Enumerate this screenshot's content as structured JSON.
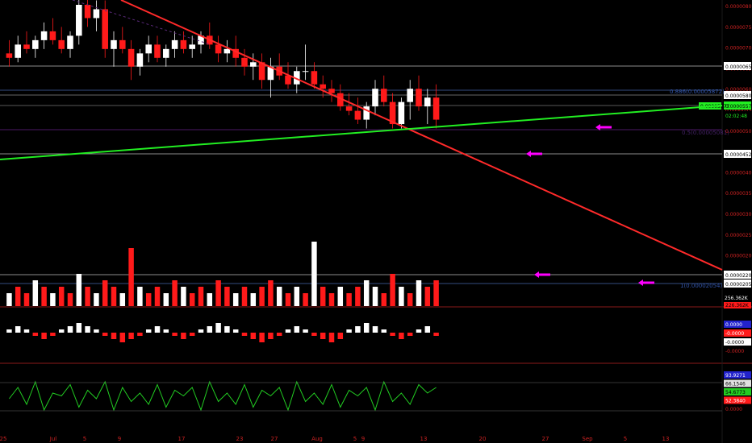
{
  "chart_data": {
    "type": "candlestick",
    "colors": {
      "background": "#000000",
      "up": "#ffffff",
      "down": "#ff1a1a",
      "axis_text": "#cc2222",
      "red_trend": "#ff2a2a",
      "green_trend": "#22ee22",
      "arrow": "#ff00ff",
      "fib": "#2255aa",
      "blue_line": "#1a30c8",
      "grey_line": "#d0d0d0",
      "orange_line": "#e87a2a",
      "green_osc": "#22cc22",
      "band": "#2a3a55"
    },
    "x_ticks": [
      "25",
      "Jul",
      "5",
      "9",
      "17",
      "23",
      "27",
      "Aug",
      "5",
      "9",
      "13",
      "20",
      "27",
      "Sep",
      "5",
      "13"
    ],
    "price_ticks": [
      "0.00000800",
      "0.00000750",
      "0.00000700",
      "0.00000650",
      "0.00000600",
      "0.00000550",
      "0.00000500",
      "0.00000450",
      "0.00000400",
      "0.00000350",
      "0.00000300",
      "0.00000250",
      "0.00000200"
    ],
    "price_labels": [
      {
        "text": "0.00000650",
        "value": 6.5e-06,
        "style": "outline"
      },
      {
        "text": "0.00005801",
        "value": 5.8e-06,
        "style": "plain"
      },
      {
        "text": "0.00005577",
        "value": 5.56e-06,
        "style": "plain"
      },
      {
        "text": "02:02:48",
        "value": 5.35e-06,
        "style": "timer"
      },
      {
        "text": "0.00004522",
        "value": 4.5e-06,
        "style": "plain"
      },
      {
        "text": "0.00002200",
        "value": 2.2e-06,
        "style": "outline"
      },
      {
        "text": "0.00002054",
        "value": 2.1e-06,
        "style": "plain"
      }
    ],
    "fib_labels": [
      {
        "text": "0.886(0.00005872)",
        "value": 5.85e-06
      },
      {
        "text": "0.5(0.00005081)",
        "value": 5.1e-06
      },
      {
        "text": "1(0.00002054)",
        "value": 2.1e-06
      }
    ],
    "current_price_tag": "0.00005577",
    "volume_labels": [
      "256.362K",
      "226.362K"
    ],
    "macd_labels": [
      "0.0000",
      "-0.0000",
      "-0.0000",
      "-0.0000"
    ],
    "stoch_labels": [
      "93.9271",
      "66.1546",
      "54.6773",
      "52.3840",
      "0.0000"
    ],
    "candles": [
      {
        "o": 6.9,
        "h": 7.2,
        "l": 6.6,
        "c": 6.8
      },
      {
        "o": 6.8,
        "h": 7.3,
        "l": 6.7,
        "c": 7.1
      },
      {
        "o": 7.1,
        "h": 7.4,
        "l": 6.9,
        "c": 7.0
      },
      {
        "o": 7.0,
        "h": 7.3,
        "l": 6.8,
        "c": 7.2
      },
      {
        "o": 7.2,
        "h": 7.6,
        "l": 7.0,
        "c": 7.4
      },
      {
        "o": 7.4,
        "h": 7.7,
        "l": 7.1,
        "c": 7.2
      },
      {
        "o": 7.2,
        "h": 7.5,
        "l": 6.9,
        "c": 7.0
      },
      {
        "o": 7.0,
        "h": 7.4,
        "l": 6.8,
        "c": 7.3
      },
      {
        "o": 7.3,
        "h": 8.2,
        "l": 7.1,
        "c": 8.0
      },
      {
        "o": 8.0,
        "h": 8.3,
        "l": 7.5,
        "c": 7.7
      },
      {
        "o": 7.7,
        "h": 8.1,
        "l": 7.4,
        "c": 7.9
      },
      {
        "o": 7.9,
        "h": 8.1,
        "l": 6.8,
        "c": 7.0
      },
      {
        "o": 7.0,
        "h": 7.4,
        "l": 6.6,
        "c": 7.2
      },
      {
        "o": 7.2,
        "h": 7.5,
        "l": 6.9,
        "c": 7.0
      },
      {
        "o": 7.0,
        "h": 7.2,
        "l": 6.3,
        "c": 6.6
      },
      {
        "o": 6.6,
        "h": 7.0,
        "l": 6.4,
        "c": 6.9
      },
      {
        "o": 6.9,
        "h": 7.3,
        "l": 6.7,
        "c": 7.1
      },
      {
        "o": 7.1,
        "h": 7.3,
        "l": 6.7,
        "c": 6.8
      },
      {
        "o": 6.8,
        "h": 7.1,
        "l": 6.6,
        "c": 7.0
      },
      {
        "o": 7.0,
        "h": 7.4,
        "l": 6.8,
        "c": 7.2
      },
      {
        "o": 7.2,
        "h": 7.4,
        "l": 6.9,
        "c": 7.0
      },
      {
        "o": 7.0,
        "h": 7.3,
        "l": 6.8,
        "c": 7.1
      },
      {
        "o": 7.1,
        "h": 7.4,
        "l": 6.9,
        "c": 7.3
      },
      {
        "o": 7.3,
        "h": 7.6,
        "l": 7.0,
        "c": 7.1
      },
      {
        "o": 7.1,
        "h": 7.3,
        "l": 6.7,
        "c": 6.9
      },
      {
        "o": 6.9,
        "h": 7.2,
        "l": 6.7,
        "c": 7.0
      },
      {
        "o": 7.0,
        "h": 7.3,
        "l": 6.6,
        "c": 6.8
      },
      {
        "o": 6.8,
        "h": 7.0,
        "l": 6.4,
        "c": 6.6
      },
      {
        "o": 6.6,
        "h": 6.9,
        "l": 6.3,
        "c": 6.7
      },
      {
        "o": 6.7,
        "h": 6.9,
        "l": 6.1,
        "c": 6.3
      },
      {
        "o": 6.3,
        "h": 6.8,
        "l": 5.9,
        "c": 6.6
      },
      {
        "o": 6.6,
        "h": 6.9,
        "l": 6.3,
        "c": 6.4
      },
      {
        "o": 6.4,
        "h": 6.7,
        "l": 6.1,
        "c": 6.2
      },
      {
        "o": 6.2,
        "h": 6.6,
        "l": 6.0,
        "c": 6.5
      },
      {
        "o": 6.5,
        "h": 7.1,
        "l": 6.3,
        "c": 6.5
      },
      {
        "o": 6.5,
        "h": 6.7,
        "l": 6.1,
        "c": 6.2
      },
      {
        "o": 6.2,
        "h": 6.4,
        "l": 5.9,
        "c": 6.1
      },
      {
        "o": 6.1,
        "h": 6.3,
        "l": 5.8,
        "c": 6.0
      },
      {
        "o": 6.0,
        "h": 6.2,
        "l": 5.6,
        "c": 5.7
      },
      {
        "o": 5.7,
        "h": 6.0,
        "l": 5.5,
        "c": 5.6
      },
      {
        "o": 5.6,
        "h": 5.9,
        "l": 5.3,
        "c": 5.4
      },
      {
        "o": 5.4,
        "h": 5.8,
        "l": 5.2,
        "c": 5.7
      },
      {
        "o": 5.7,
        "h": 6.3,
        "l": 5.5,
        "c": 6.1
      },
      {
        "o": 6.1,
        "h": 6.4,
        "l": 5.7,
        "c": 5.8
      },
      {
        "o": 5.8,
        "h": 6.0,
        "l": 5.2,
        "c": 5.3
      },
      {
        "o": 5.3,
        "h": 5.9,
        "l": 5.2,
        "c": 5.8
      },
      {
        "o": 5.8,
        "h": 6.3,
        "l": 5.4,
        "c": 6.1
      },
      {
        "o": 6.1,
        "h": 6.4,
        "l": 5.6,
        "c": 5.7
      },
      {
        "o": 5.7,
        "h": 6.1,
        "l": 5.3,
        "c": 5.9
      },
      {
        "o": 5.9,
        "h": 6.2,
        "l": 5.2,
        "c": 5.4
      }
    ],
    "volumes": [
      2,
      3,
      2,
      4,
      3,
      2,
      3,
      2,
      5,
      3,
      2,
      4,
      3,
      2,
      9,
      3,
      2,
      3,
      2,
      4,
      3,
      2,
      3,
      2,
      4,
      3,
      2,
      3,
      2,
      3,
      4,
      3,
      2,
      3,
      2,
      10,
      3,
      2,
      3,
      2,
      3,
      4,
      3,
      2,
      5,
      3,
      2,
      4,
      3,
      4
    ],
    "volume_down": [
      false,
      true,
      true,
      false,
      true,
      false,
      true,
      true,
      false,
      true,
      false,
      true,
      true,
      false,
      true,
      false,
      true,
      true,
      false,
      true,
      false,
      true,
      true,
      false,
      true,
      true,
      false,
      true,
      false,
      true,
      true,
      false,
      true,
      false,
      true,
      false,
      true,
      true,
      false,
      true,
      true,
      false,
      false,
      true,
      true,
      false,
      true,
      false,
      true,
      true
    ],
    "macd_hist": [
      1,
      2,
      1,
      -1,
      -2,
      -1,
      1,
      2,
      3,
      2,
      1,
      -1,
      -2,
      -3,
      -2,
      -1,
      1,
      2,
      1,
      -1,
      -2,
      -1,
      1,
      2,
      3,
      2,
      1,
      -1,
      -2,
      -3,
      -2,
      -1,
      1,
      2,
      1,
      -1,
      -2,
      -3,
      -2,
      1,
      2,
      3,
      2,
      1,
      -1,
      -2,
      -1,
      1,
      2,
      -1
    ],
    "stoch_osc": [
      50,
      70,
      40,
      80,
      30,
      60,
      55,
      75,
      35,
      65,
      50,
      80,
      30,
      70,
      45,
      60,
      40,
      75,
      35,
      65,
      55,
      70,
      30,
      80,
      45,
      60,
      40,
      75,
      35,
      65,
      55,
      70,
      30,
      80,
      45,
      60,
      40,
      75,
      35,
      65,
      55,
      70,
      30,
      80,
      45,
      60,
      40,
      75,
      60,
      70
    ]
  }
}
